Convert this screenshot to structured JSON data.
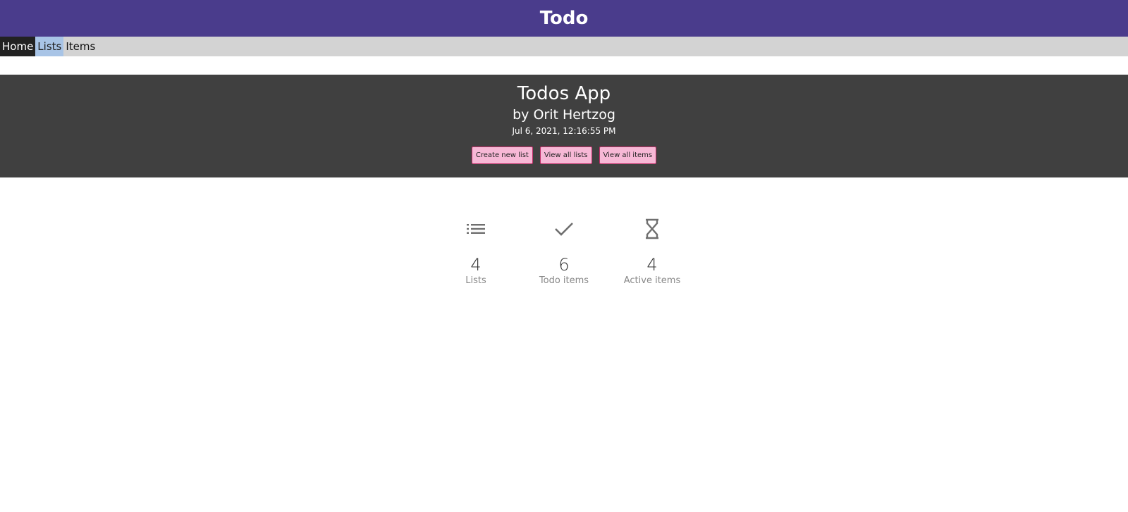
{
  "header": {
    "title": "Todo"
  },
  "nav": {
    "items": [
      {
        "label": "Home"
      },
      {
        "label": "Lists"
      },
      {
        "label": "Items"
      }
    ]
  },
  "hero": {
    "title": "Todos App",
    "subtitle": "by Orit Hertzog",
    "date": "Jul 6, 2021, 12:16:55 PM",
    "buttons": {
      "create": "Create new list",
      "view_lists": "View all lists",
      "view_items": "View all items"
    }
  },
  "stats": [
    {
      "icon": "list-icon",
      "count": "4",
      "label": "Lists"
    },
    {
      "icon": "check-icon",
      "count": "6",
      "label": "Todo items"
    },
    {
      "icon": "hourglass-icon",
      "count": "4",
      "label": "Active items"
    }
  ],
  "colors": {
    "header_bg": "#4a3c8c",
    "nav_bg": "#d3d3d3",
    "nav_active_bg": "#222222",
    "nav_hover_bg": "#a8c4e6",
    "hero_bg": "#404040",
    "button_bg": "#f7b8d6",
    "button_border": "#c0306a",
    "icon_color": "#6f6f6f"
  }
}
